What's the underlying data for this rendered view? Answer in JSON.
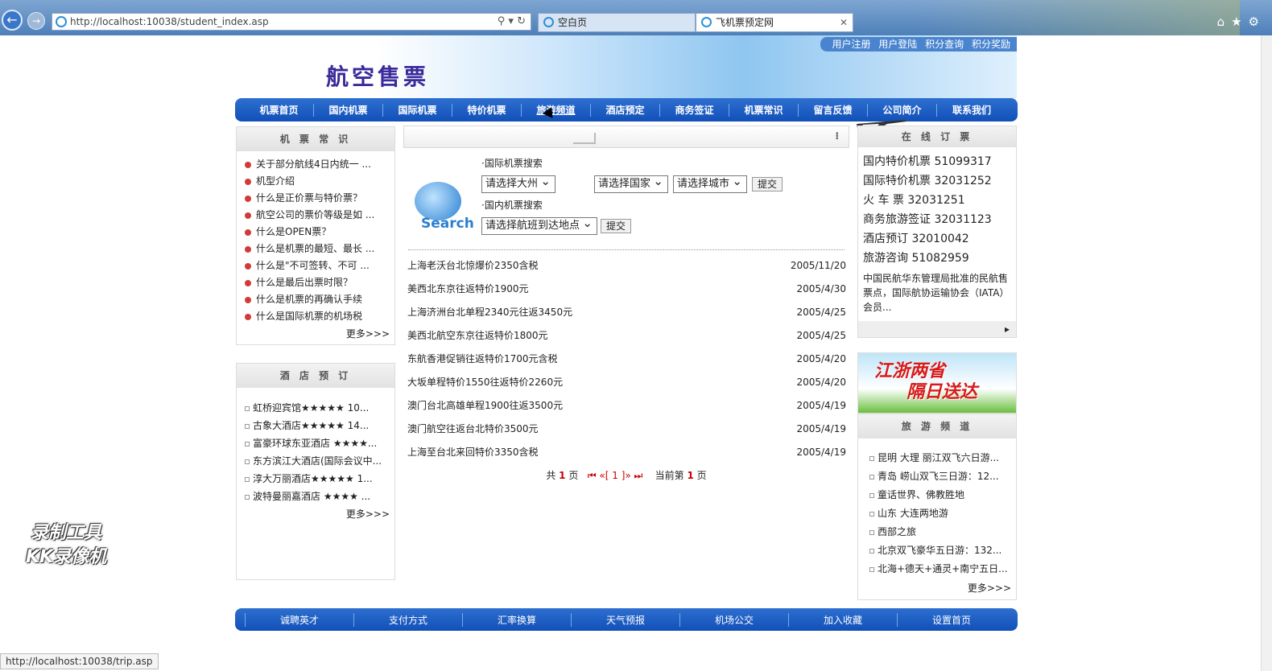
{
  "browser": {
    "url": "http://localhost:10038/student_index.asp",
    "tabs": [
      {
        "label": "空白页"
      },
      {
        "label": "飞机票预定网"
      }
    ],
    "status_url": "http://localhost:10038/trip.asp"
  },
  "header": {
    "site_title": "航空售票",
    "top_links": [
      "用户注册",
      "用户登陆",
      "积分查询",
      "积分奖励"
    ]
  },
  "nav": [
    "机票首页",
    "国内机票",
    "国际机票",
    "特价机票",
    "旅游频道",
    "酒店预定",
    "商务签证",
    "机票常识",
    "留言反馈",
    "公司简介",
    "联系我们"
  ],
  "knowledge": {
    "title": "机 票 常 识",
    "items": [
      "关于部分航线4日内统一 ...",
      "机型介绍",
      "什么是正价票与特价票？",
      "航空公司的票价等级是如 ...",
      "什么是OPEN票？",
      "什么是机票的最短、最长 ...",
      "什么是\"不可签转、不可 ...",
      "什么是最后出票时限？",
      "什么是机票的再确认手续",
      "什么是国际机票的机场税"
    ],
    "more": "更多>>>"
  },
  "hotels": {
    "title": "酒 店 预 订",
    "items": [
      "虹桥迎宾馆★★★★★ 10...",
      "古象大酒店★★★★★ 14...",
      "富豪环球东亚酒店 ★★★★...",
      "东方滨江大酒店(国际会议中...",
      "淳大万丽酒店★★★★★ 1...",
      "波特曼丽嘉酒店 ★★★★ ..."
    ],
    "more": "更多>>>"
  },
  "search": {
    "logo_text": "Search",
    "intl_label": "·国际机票搜索",
    "continent": "请选择大州",
    "country": "请选择国家",
    "city": "请选择城市",
    "submit": "提交",
    "domestic_label": "·国内机票搜索",
    "destination": "请选择航班到达地点"
  },
  "news": [
    {
      "title": "上海老沃台北惊爆价2350含税",
      "date": "2005/11/20"
    },
    {
      "title": "美西北东京往返特价1900元",
      "date": "2005/4/30"
    },
    {
      "title": "上海济洲台北单程2340元往返3450元",
      "date": "2005/4/25"
    },
    {
      "title": "美西北航空东京往返特价1800元",
      "date": "2005/4/25"
    },
    {
      "title": "东航香港促销往返特价1700元含税",
      "date": "2005/4/20"
    },
    {
      "title": "大坂单程特价1550往返特价2260元",
      "date": "2005/4/20"
    },
    {
      "title": "澳门台北高雄单程1900往返3500元",
      "date": "2005/4/19"
    },
    {
      "title": "澳门航空往返台北特价3500元",
      "date": "2005/4/19"
    },
    {
      "title": "上海至台北来回特价3350含税",
      "date": "2005/4/19"
    }
  ],
  "pager": {
    "total_prefix": "共",
    "total": "1",
    "total_suffix": "页",
    "nav": "⏮ «[ 1 ]» ⏭",
    "current_prefix": "当前第",
    "current": "1",
    "current_suffix": "页"
  },
  "online": {
    "title": "在 线 订 票",
    "lines": [
      "国内特价机票 51099317",
      "国际特价机票 32031252",
      "火 车 票 32031251",
      "商务旅游签证 32031123",
      "酒店预订 32010042",
      "旅游咨询 51082959"
    ],
    "note": "中国民航华东管理局批准的民航售票点，国际航协运输协会（IATA）会员..."
  },
  "promo": {
    "line1": "江浙两省",
    "line2": "隔日送达"
  },
  "travel": {
    "title": "旅 游 频 道",
    "items": [
      "昆明 大理 丽江双飞六日游...",
      "青岛 崂山双飞三日游：12...",
      "童话世界、佛教胜地",
      "山东 大连两地游",
      "西部之旅",
      "北京双飞豪华五日游：132...",
      "北海+德天+通灵+南宁五日..."
    ],
    "more": "更多>>>"
  },
  "footer": [
    "诚聘英才",
    "支付方式",
    "汇率换算",
    "天气预报",
    "机场公交",
    "加入收藏",
    "设置首页"
  ],
  "watermark": {
    "line1": "录制工具",
    "line2": "KK录像机"
  },
  "colors": {
    "nav_blue": "#1250b8",
    "title_purple": "#3a2a9a",
    "bullet_red": "#d23a3a"
  }
}
